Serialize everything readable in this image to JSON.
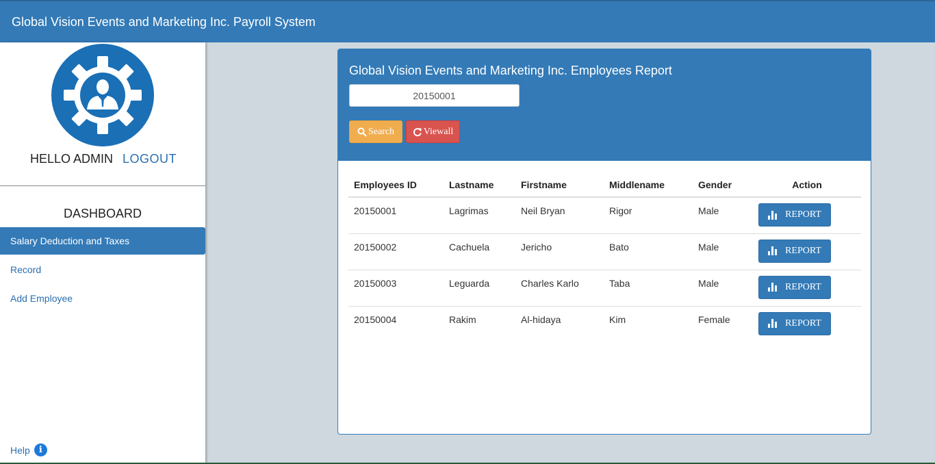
{
  "app": {
    "title": "Global Vision Events and Marketing Inc. Payroll System"
  },
  "sidebar": {
    "greeting": "HELLO ADMIN",
    "logout_label": "LOGOUT",
    "dashboard_title": "DASHBOARD",
    "items": [
      {
        "label": "Salary Deduction and Taxes",
        "active": true
      },
      {
        "label": "Record",
        "active": false
      },
      {
        "label": "Add Employee",
        "active": false
      }
    ],
    "help_label": "Help",
    "help_icon": "info-icon"
  },
  "report": {
    "title": "Global Vision Events and Marketing Inc. Employees Report",
    "search_value": "20150001",
    "search_label": "Search",
    "viewall_label": "Viewall",
    "columns": [
      "Employees ID",
      "Lastname",
      "Firstname",
      "Middlename",
      "Gender",
      "Action"
    ],
    "action_label": "REPORT",
    "rows": [
      {
        "id": "20150001",
        "lastname": "Lagrimas",
        "firstname": "Neil Bryan",
        "middlename": "Rigor",
        "gender": "Male"
      },
      {
        "id": "20150002",
        "lastname": "Cachuela",
        "firstname": "Jericho",
        "middlename": "Bato",
        "gender": "Male"
      },
      {
        "id": "20150003",
        "lastname": "Leguarda",
        "firstname": "Charles Karlo",
        "middlename": "Taba",
        "gender": "Male"
      },
      {
        "id": "20150004",
        "lastname": "Rakim",
        "firstname": "Al-hidaya",
        "middlename": "Kim",
        "gender": "Female"
      }
    ]
  },
  "colors": {
    "primary": "#337ab7",
    "warning": "#f0ad4e",
    "danger": "#d9534f",
    "background": "#cfd8de"
  }
}
